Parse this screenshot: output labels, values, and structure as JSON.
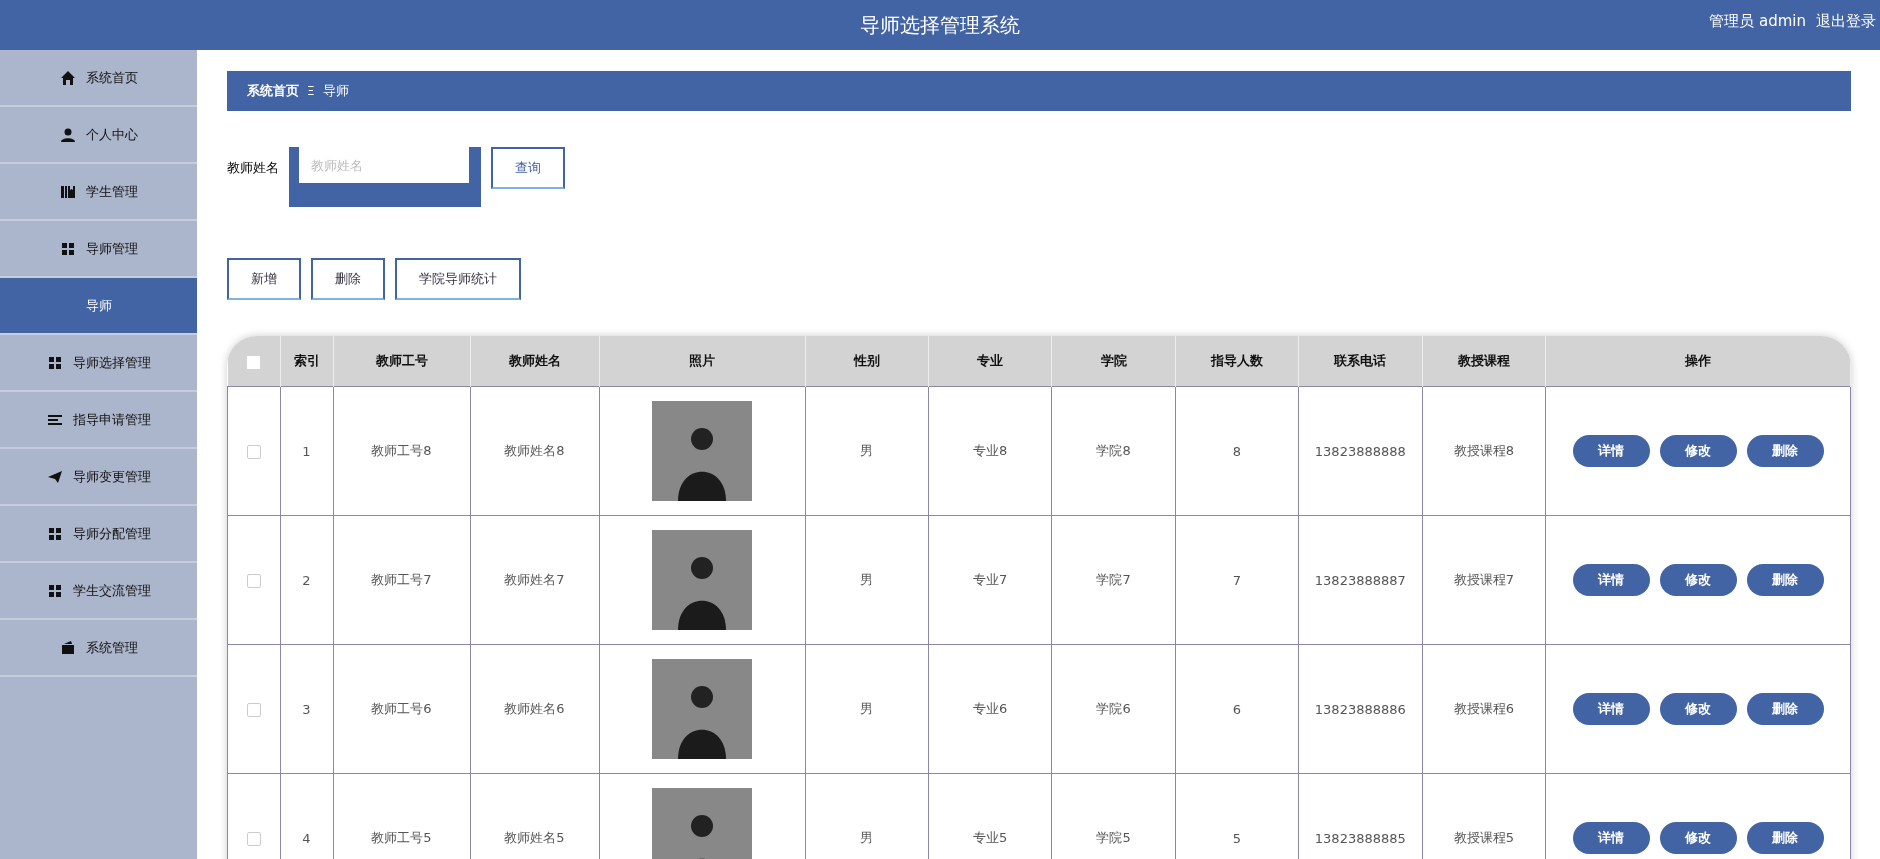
{
  "header": {
    "title": "导师选择管理系统",
    "user": "管理员 admin",
    "logout": "退出登录"
  },
  "sidebar": {
    "items": [
      {
        "label": "系统首页",
        "selected": false
      },
      {
        "label": "个人中心",
        "selected": false
      },
      {
        "label": "学生管理",
        "selected": false
      },
      {
        "label": "导师管理",
        "selected": false,
        "children": [
          {
            "label": "导师",
            "selected": true
          }
        ]
      },
      {
        "label": "导师选择管理",
        "selected": false
      },
      {
        "label": "指导申请管理",
        "selected": false
      },
      {
        "label": "导师变更管理",
        "selected": false
      },
      {
        "label": "导师分配管理",
        "selected": false
      },
      {
        "label": "学生交流管理",
        "selected": false
      },
      {
        "label": "系统管理",
        "selected": false
      }
    ]
  },
  "breadcrumb": {
    "items": [
      "系统首页",
      "导师"
    ],
    "separator": "Ξ"
  },
  "search": {
    "label": "教师姓名",
    "placeholder": "教师姓名",
    "button": "查询"
  },
  "actions": [
    "新增",
    "删除",
    "学院导师统计"
  ],
  "table": {
    "select_all_checked": false,
    "columns": [
      "索引",
      "教师工号",
      "教师姓名",
      "照片",
      "性别",
      "专业",
      "学院",
      "指导人数",
      "联系电话",
      "教授课程",
      "操作"
    ],
    "rows": [
      {
        "checked": false,
        "cells": [
          "1",
          "教师工号8",
          "教师姓名8",
          "",
          "男",
          "专业8",
          "学院8",
          "8",
          "13823888888",
          "教授课程8"
        ],
        "buttons": [
          "详情",
          "修改",
          "删除"
        ]
      },
      {
        "checked": false,
        "cells": [
          "2",
          "教师工号7",
          "教师姓名7",
          "",
          "男",
          "专业7",
          "学院7",
          "7",
          "13823888887",
          "教授课程7"
        ],
        "buttons": [
          "详情",
          "修改",
          "删除"
        ]
      },
      {
        "checked": false,
        "cells": [
          "3",
          "教师工号6",
          "教师姓名6",
          "",
          "男",
          "专业6",
          "学院6",
          "6",
          "13823888886",
          "教授课程6"
        ],
        "buttons": [
          "详情",
          "修改",
          "删除"
        ]
      },
      {
        "checked": false,
        "cells": [
          "4",
          "教师工号5",
          "教师姓名5",
          "",
          "男",
          "专业5",
          "学院5",
          "5",
          "13823888885",
          "教授课程5"
        ],
        "buttons": [
          "详情",
          "修改",
          "删除"
        ]
      }
    ]
  }
}
